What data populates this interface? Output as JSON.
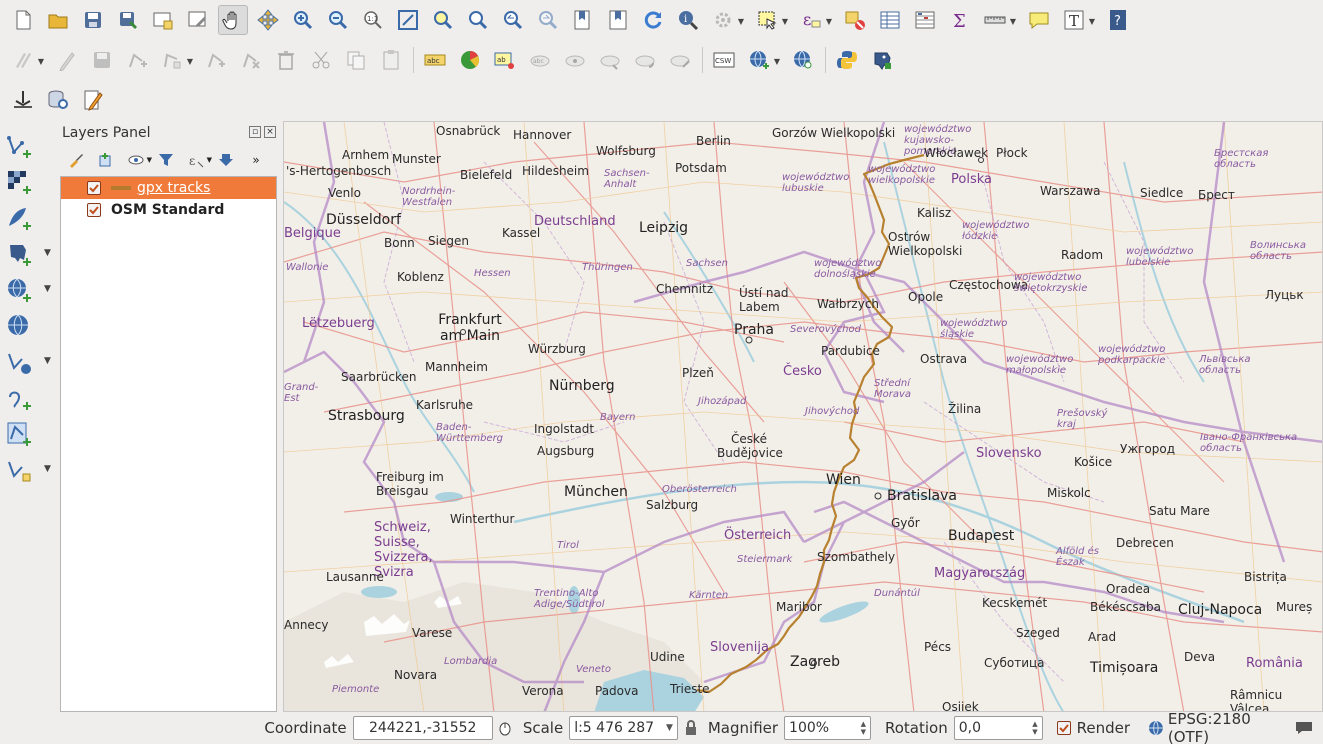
{
  "toolbar": {
    "row1": [
      "new-project",
      "open-project",
      "save-project",
      "save-as",
      "new-print-layout",
      "layout-manager",
      "pan-map",
      "pan-to-selection",
      "zoom-in",
      "zoom-out",
      "zoom-native",
      "zoom-full",
      "zoom-to-selection",
      "zoom-to-layer",
      "zoom-last",
      "zoom-next",
      "new-bookmark",
      "show-bookmarks",
      "refresh",
      "identify",
      "measure-area",
      "select-features",
      "deselect",
      "field-calculator",
      "statistics",
      "attribute-table",
      "measure-line",
      "text-annotation",
      "map-tips",
      "help"
    ],
    "row2": [
      "toggle-editing",
      "current-edits",
      "save-edits",
      "add-feature",
      "vertex-tool",
      "add-ring",
      "delete-part",
      "delete-selected",
      "cut-features",
      "copy-features",
      "paste-features",
      "label-tool",
      "pie-diagram",
      "highlight-labels",
      "pin-labels",
      "show-hide-labels",
      "move-label",
      "rotate-label",
      "change-label",
      "csw",
      "metasearch",
      "wms-search",
      "python-console",
      "db-manager"
    ],
    "row3": [
      "gps-tools",
      "db-manager-2",
      "edit-features"
    ]
  },
  "left_toolbar": [
    "add-vector-layer",
    "add-raster-layer",
    "add-delimited-text",
    "add-postgis-layer",
    "add-spatialite-layer",
    "add-wms-layer",
    "add-wcs-layer",
    "add-wfs-layer",
    "add-mesh-layer",
    "add-virtual-layer",
    "add-gpx-layer"
  ],
  "layers_panel": {
    "title": "Layers Panel",
    "layers": [
      {
        "name": "gpx tracks",
        "checked": true,
        "selected": true,
        "symbol_color": "#b47a2e"
      },
      {
        "name": "OSM Standard",
        "checked": true,
        "selected": false
      }
    ]
  },
  "map": {
    "track_color": "#b7812f",
    "background_color": "#f2efe9",
    "labels": {
      "osnabruck": "Osnabrück",
      "hannover": "Hannover",
      "berlin": "Berlin",
      "gorzow": "Gorzów Wielkopolski",
      "kujawsko": "województwo kujawsko-pomorskie",
      "arnhem": "Arnhem",
      "munster": "Munster",
      "wolfsburg": "Wolfsburg",
      "wloclawek": "Włocławek",
      "plock": "Płock",
      "brest_reg": "Брестская область",
      "hertogenbosch": "'s-Hertogenbosch",
      "bielefeld": "Bielefeld",
      "hildesheim": "Hildesheim",
      "sachsen_anhalt": "Sachsen-Anhalt",
      "potsdam": "Potsdam",
      "wielkopolskie": "województwo wielkopolskie",
      "lubuskie": "województwo lubuskie",
      "polska": "Polska",
      "venlo": "Venlo",
      "nrw": "Nordrhein-Westfalen",
      "warszawa": "Warszawa",
      "siedlce": "Siedlce",
      "brest": "Брест",
      "dusseldorf": "Düsseldorf",
      "deutschland": "Deutschland",
      "leipzig": "Leipzig",
      "kalisz": "Kalisz",
      "belgique": "Belgique",
      "bonn": "Bonn",
      "siegen": "Siegen",
      "kassel": "Kassel",
      "ostrow": "Ostrów Wielkopolski",
      "lodzkie": "województwo łódzkie",
      "radom": "Radom",
      "lubelskie": "województwo lubelskie",
      "volynska": "Волинська область",
      "wallonie": "Wallonie",
      "koblenz": "Koblenz",
      "hessen": "Hessen",
      "thuringen": "Thüringen",
      "sachsen": "Sachsen",
      "dolnoslaskie": "województwo dolnośląskie",
      "chemnitz": "Chemnitz",
      "usti": "Ústí nad Labem",
      "walbrzych": "Wałbrzych",
      "opole": "Opole",
      "czestochowa": "Częstochowa",
      "swietokrzyskie": "województwo świętokrzyskie",
      "lutsk": "Луцьк",
      "letzebuerg": "Lëtzebuerg",
      "frankfurt": "Frankfurt am Main",
      "severovychod": "Severovýchod",
      "slaskie": "województwo śląskie",
      "praha": "Praha",
      "wurzburg": "Würzburg",
      "pardubice": "Pardubice",
      "ostrava": "Ostrava",
      "malopolskie": "województwo małopolskie",
      "podkarpackie": "województwo podkarpackie",
      "lviv": "Львівська область",
      "mannheim": "Mannheim",
      "saarbrucken": "Saarbrücken",
      "nurnberg": "Nürnberg",
      "plzen": "Plzeň",
      "cesko": "Česko",
      "stredni_morava": "Střední Morava",
      "grand_est": "Grand-Est",
      "karlsruhe": "Karlsruhe",
      "jihozapad": "Jihozápad",
      "bayern": "Bayern",
      "jihovychod": "Jihovýchod",
      "zilina": "Žilina",
      "presovsky": "Prešovský kraj",
      "strasbourg": "Strasbourg",
      "ingolstadt": "Ingolstadt",
      "bw": "Baden-Württemberg",
      "augsburg": "Augsburg",
      "ceske_budejovice": "České Budějovice",
      "slovensko": "Slovensko",
      "kosice": "Košice",
      "uzhhorod": "Ужгород",
      "ivano": "Івано-Франківська область",
      "wien": "Wien",
      "bratislava": "Bratislava",
      "freiburg": "Freiburg im Breisgau",
      "oberosterreich": "Oberösterreich",
      "munchen": "München",
      "salzburg": "Salzburg",
      "miskolc": "Miskolc",
      "satu_mare": "Satu Mare",
      "winterthur": "Winterthur",
      "gyor": "Győr",
      "schweiz": "Schweiz, Suisse, Svizzera, Svizra",
      "tirol": "Tirol",
      "osterreich": "Österreich",
      "budapest": "Budapest",
      "alfold": "Alföld és Észak",
      "debrecen": "Debrecen",
      "steiermark": "Steiermark",
      "szombathely": "Szombathely",
      "magyarorszag": "Magyarország",
      "bistrita": "Bistrița",
      "lausanne": "Lausanne",
      "oradea": "Oradea",
      "trentino": "Trentino-Alto Adige/Südtirol",
      "karnten": "Kärnten",
      "dunantul": "Dunántúl",
      "kecskemet": "Kecskemét",
      "bekescsaba": "Békéscsaba",
      "cluj": "Cluj-Napoca",
      "mures": "Mureș",
      "maribor": "Maribor",
      "annecy": "Annecy",
      "varese": "Varese",
      "slovenija": "Slovenija",
      "szeged": "Szeged",
      "arad": "Arad",
      "pecs": "Pécs",
      "lombardia": "Lombardia",
      "udine": "Udine",
      "zagreb": "Zagreb",
      "subotica": "Суботица",
      "deva": "Deva",
      "romania": "România",
      "novara": "Novara",
      "veneto": "Veneto",
      "timisoara": "Timișoara",
      "piemonte": "Piemonte",
      "verona": "Verona",
      "padova": "Padova",
      "trieste": "Trieste",
      "ramnicu": "Râmnicu Vâlcea",
      "osijek": "Osijek"
    }
  },
  "statusbar": {
    "coordinate_label": "Coordinate",
    "coordinate_value": "244221,-31552",
    "scale_label": "Scale",
    "scale_value": "l:5 476 287",
    "magnifier_label": "Magnifier",
    "magnifier_value": "100%",
    "rotation_label": "Rotation",
    "rotation_value": "0,0",
    "render_label": "Render",
    "render_checked": true,
    "crs_label": "EPSG:2180 (OTF)"
  }
}
